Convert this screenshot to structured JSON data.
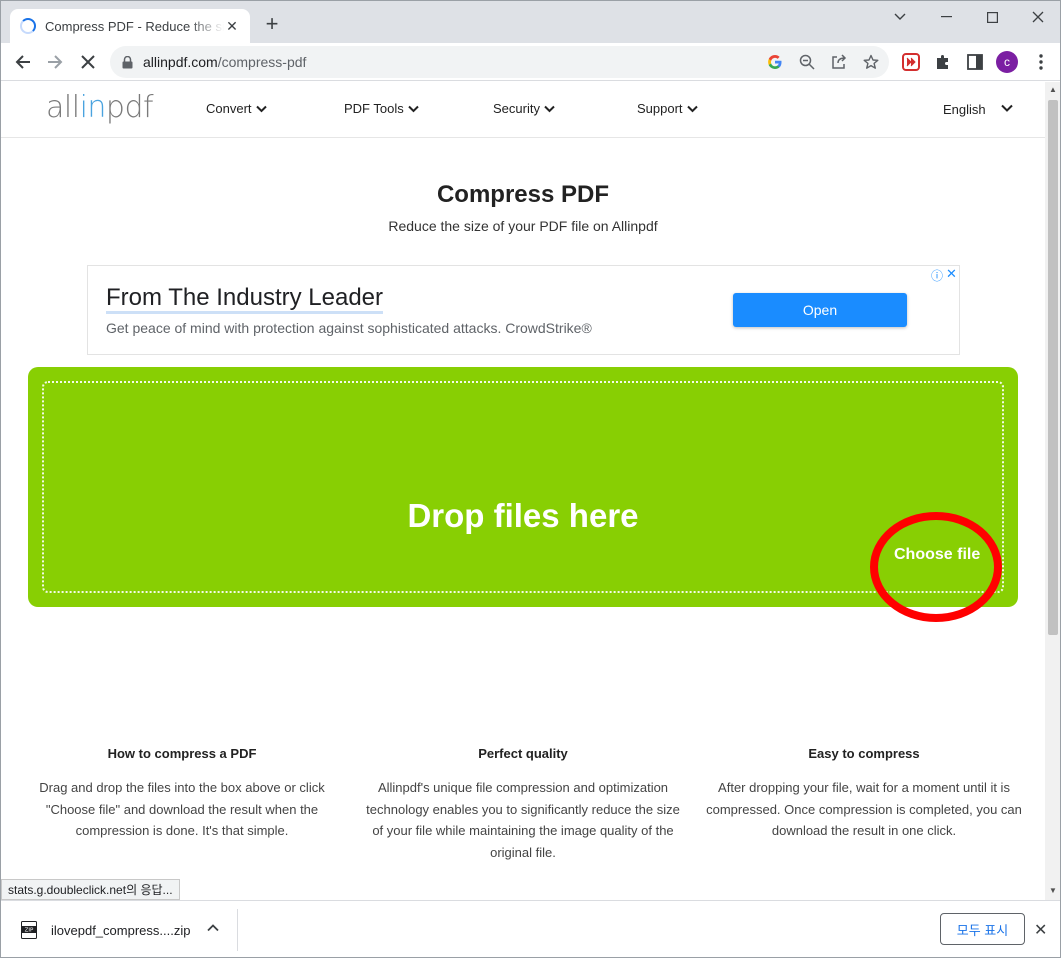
{
  "browser": {
    "tab": {
      "title": "Compress PDF - Reduce the size of your PDF file",
      "close": "✕"
    },
    "new_tab": "+",
    "window_controls": {
      "minimize": "—",
      "maximize": "☐",
      "close": "✕"
    },
    "url": {
      "domain": "allinpdf.com",
      "path": "/compress-pdf"
    },
    "profile_initial": "c",
    "accent": "#1a73e8"
  },
  "site": {
    "logo": {
      "part1": "all",
      "part2": "in",
      "part3": "pdf"
    },
    "menu": [
      {
        "label": "Convert"
      },
      {
        "label": "PDF Tools"
      },
      {
        "label": "Security"
      },
      {
        "label": "Support"
      }
    ],
    "language": "English"
  },
  "main": {
    "title": "Compress PDF",
    "subtitle": "Reduce the size of your PDF file on Allinpdf"
  },
  "ad": {
    "headline": "From The Industry Leader",
    "description": "Get peace of mind with protection against sophisticated attacks. CrowdStrike®",
    "button": "Open",
    "info": "ⓘ",
    "close": "✕"
  },
  "dropzone": {
    "text": "Drop files here",
    "choose_button": "Choose file",
    "color": "#88cf03",
    "highlight_color": "#ff0000"
  },
  "features": [
    {
      "title": "How to compress a PDF",
      "text": "Drag and drop the files into the box above or click \"Choose file\" and download the result when the compression is done. It's that simple."
    },
    {
      "title": "Perfect quality",
      "text": "Allinpdf's unique file compression and optimization technology enables you to significantly reduce the size of your file while maintaining the image quality of the original file."
    },
    {
      "title": "Easy to compress",
      "text": "After dropping your file, wait for a moment until it is compressed. Once compression is completed, you can download the result in one click."
    }
  ],
  "status_text": "stats.g.doubleclick.net의 응답...",
  "download_shelf": {
    "file_name": "ilovepdf_compress....zip",
    "show_all": "모두 표시",
    "close": "✕"
  }
}
